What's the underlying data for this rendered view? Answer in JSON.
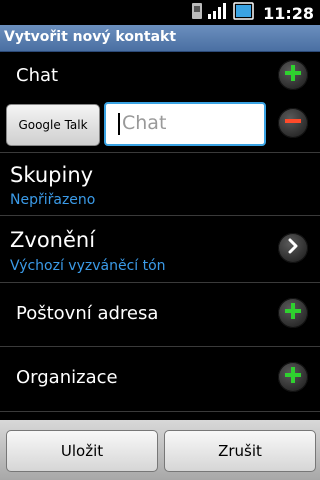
{
  "status_bar": {
    "time": "11:28",
    "icons": [
      "sim-icon",
      "signal-icon",
      "battery-icon"
    ]
  },
  "title_bar": {
    "title": "Vytvořit nový kontakt"
  },
  "chat_section": {
    "label": "Chat",
    "add_icon": "plus-icon",
    "type_button_label": "Google Talk",
    "input_placeholder": "Chat",
    "input_value": "",
    "remove_icon": "minus-icon"
  },
  "groups": {
    "label": "Skupiny",
    "value": "Nepřiřazeno"
  },
  "ringtone": {
    "label": "Zvonění",
    "value": "Výchozí vyzváněcí tón",
    "icon": "chevron-right-icon"
  },
  "postal": {
    "label": "Poštovní adresa",
    "add_icon": "plus-icon"
  },
  "organization": {
    "label": "Organizace",
    "add_icon": "plus-icon"
  },
  "bottom_bar": {
    "save_label": "Uložit",
    "cancel_label": "Zrušit"
  },
  "colors": {
    "accent": "#3aa3e3",
    "link": "#3b9be8",
    "plus": "#2fd12f",
    "minus": "#ff4a2a"
  }
}
